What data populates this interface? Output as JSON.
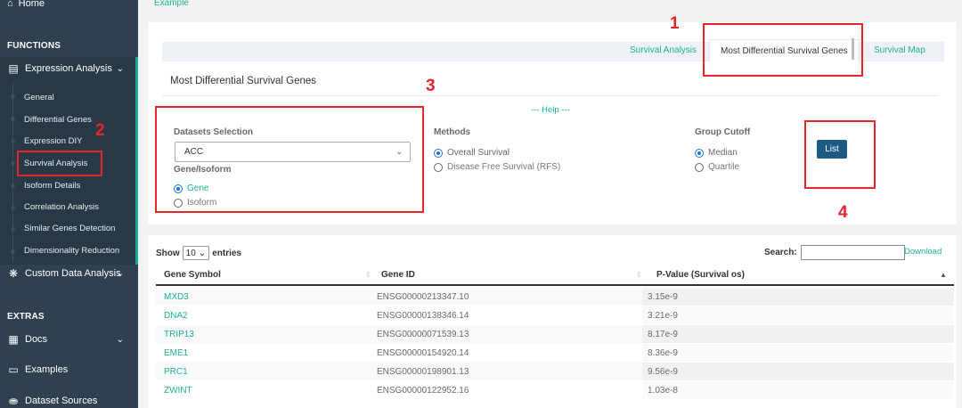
{
  "sidebar": {
    "home": "Home",
    "functions_heading": "FUNCTIONS",
    "expression_analysis": "Expression Analysis",
    "sub_items": [
      "General",
      "Differential Genes",
      "Expression DIY",
      "Survival Analysis",
      "Isoform Details",
      "Correlation Analysis",
      "Similar Genes Detection",
      "Dimensionality Reduction"
    ],
    "custom_data_analysis": "Custom Data Analysis",
    "extras_heading": "EXTRAS",
    "docs": "Docs",
    "examples": "Examples",
    "dataset_sources": "Dataset Sources"
  },
  "breadcrumb": "Example",
  "tabs": {
    "survival_analysis": "Survival Analysis",
    "most_diff": "Most Differential Survival Genes",
    "survival_map": "Survival Map"
  },
  "panel": {
    "title": "Most Differential Survival Genes",
    "help": "--- Help ---",
    "datasets_label": "Datasets Selection",
    "dataset_value": "ACC",
    "gene_isoform_label": "Gene/Isoform",
    "gene": "Gene",
    "isoform": "Isoform",
    "methods_label": "Methods",
    "overall_survival": "Overall Survival",
    "disease_free": "Disease Free Survival (RFS)",
    "group_cutoff_label": "Group Cutoff",
    "median": "Median",
    "quartile": "Quartile",
    "list_button": "List"
  },
  "annotations": [
    "1",
    "2",
    "3",
    "4"
  ],
  "table": {
    "show": "Show",
    "entries_value": "10",
    "entries": "entries",
    "search": "Search:",
    "download": "Download",
    "headers": [
      "Gene Symbol",
      "Gene ID",
      "P-Value (Survival os)"
    ],
    "rows": [
      [
        "MXD3",
        "ENSG00000213347.10",
        "3.15e-9"
      ],
      [
        "DNA2",
        "ENSG00000138346.14",
        "3.21e-9"
      ],
      [
        "TRIP13",
        "ENSG00000071539.13",
        "8.17e-9"
      ],
      [
        "EME1",
        "ENSG00000154920.14",
        "8.36e-9"
      ],
      [
        "PRC1",
        "ENSG00000198901.13",
        "9.56e-9"
      ],
      [
        "ZWINT",
        "ENSG00000122952.16",
        "1.03e-8"
      ]
    ]
  },
  "colors": {
    "accent": "#1ab394",
    "sidebar": "#2f4050",
    "annotation": "#e5252a",
    "button": "#1c5a83"
  }
}
